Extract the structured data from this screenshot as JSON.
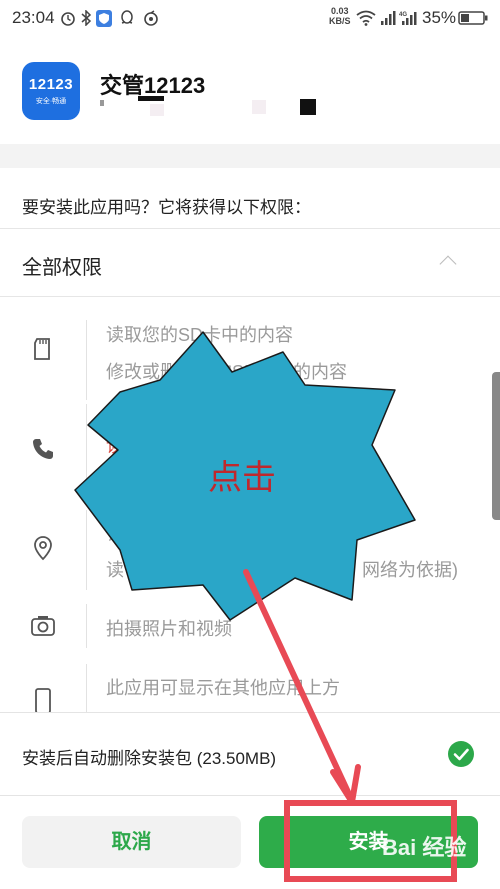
{
  "status_bar": {
    "time": "23:04",
    "speed_value": "0.03",
    "speed_unit": "KB/S",
    "battery": "35%",
    "icons": [
      "alarm-icon",
      "bluetooth-icon",
      "shield-app-icon",
      "qq-icon",
      "netease-icon",
      "wifi-icon",
      "signal-icon",
      "signal-4g-icon",
      "battery-icon"
    ]
  },
  "app": {
    "icon_number": "12123",
    "icon_subtitle": "安全·畅通",
    "name": "交管12123"
  },
  "prompt": {
    "question": "要安装此应用吗？它将获得以下权限：",
    "section_title": "全部权限"
  },
  "permissions": [
    {
      "icon": "sd-card-icon",
      "lines": [
        "读取您的SD卡中的内容",
        "修改或删除您的SD卡中的内容"
      ],
      "visible_fragments": [
        "修改或删",
        "D卡中的内容"
      ]
    },
    {
      "icon": "phone-icon",
      "lines": [
        "拨",
        "读"
      ]
    },
    {
      "icon": "location-icon",
      "lines": [
        "订",
        "读"
      ],
      "tail_fragment": "网络为依据)"
    },
    {
      "icon": "camera-icon",
      "lines": [
        "拍摄照片和视频"
      ]
    },
    {
      "icon": "phone-device-icon",
      "lines": [
        "此应用可显示在其他应用上方"
      ]
    }
  ],
  "footer": {
    "auto_delete": "安装后自动删除安装包 (23.50MB)",
    "cancel_label": "取消",
    "install_label": "安装"
  },
  "annotation": {
    "label": "点击",
    "starburst_color": "#2aa6c8",
    "arrow_color": "#e84a55",
    "highlight_color": "#e84a55"
  },
  "watermark": {
    "text": "Bai 经验"
  },
  "colors": {
    "accent_green": "#2eac4a",
    "app_icon_blue": "#1e6fe0",
    "warning_red": "#d9463c"
  }
}
